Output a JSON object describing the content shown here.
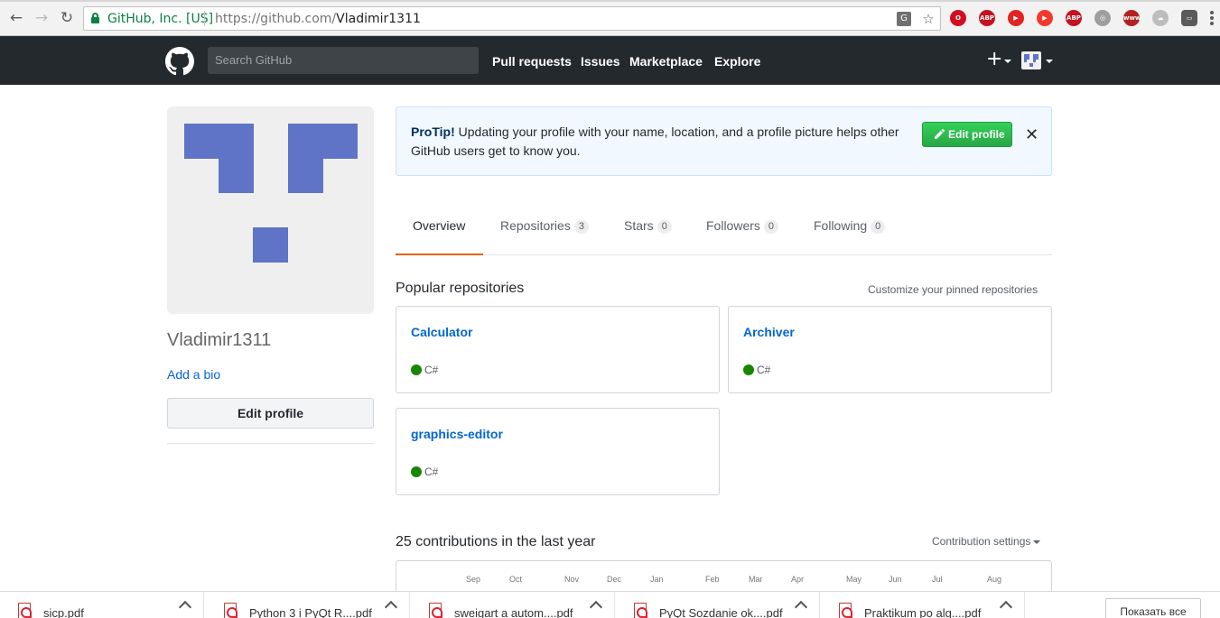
{
  "browser": {
    "secure_label": "GitHub, Inc. [US]",
    "url_prefix": "https://github.com/",
    "url_path": "Vladimir1311",
    "extensions": [
      {
        "name": "opera-icon",
        "color": "#d30d1f",
        "label": "O"
      },
      {
        "name": "adblock-icon",
        "color": "#c5131f",
        "label": "ABP"
      },
      {
        "name": "video-icon",
        "color": "#e02424",
        "label": "▶"
      },
      {
        "name": "video-speed-icon",
        "color": "#f03a2c",
        "label": "▶"
      },
      {
        "name": "adblock-plus-icon",
        "color": "#c5131f",
        "label": "ABP"
      },
      {
        "name": "proxy-icon",
        "color": "#9e9e9e",
        "label": "◎"
      },
      {
        "name": "www-icon",
        "color": "#b22222",
        "label": "www"
      },
      {
        "name": "cloud-icon",
        "color": "#bdbdbd",
        "label": "☁"
      },
      {
        "name": "cast-icon",
        "color": "#5a5a5a",
        "label": "▭"
      },
      {
        "name": "addon-icon",
        "color": "#d32f2f",
        "label": "✦"
      }
    ]
  },
  "header": {
    "search_placeholder": "Search GitHub",
    "nav": [
      "Pull requests",
      "Issues",
      "Marketplace",
      "Explore"
    ],
    "plus_label": "+"
  },
  "profile": {
    "username": "Vladimir1311",
    "add_bio": "Add a bio",
    "edit_profile": "Edit profile"
  },
  "protip": {
    "title": "ProTip!",
    "text": "Updating your profile with your name, location, and a profile picture helps other GitHub users get to know you.",
    "button": "Edit profile",
    "close": "✕"
  },
  "tabs": [
    {
      "label": "Overview",
      "count": null
    },
    {
      "label": "Repositories",
      "count": "3"
    },
    {
      "label": "Stars",
      "count": "0"
    },
    {
      "label": "Followers",
      "count": "0"
    },
    {
      "label": "Following",
      "count": "0"
    }
  ],
  "popular": {
    "title": "Popular repositories",
    "customize": "Customize your pinned repositories",
    "repos": [
      {
        "name": "Calculator",
        "language": "C#",
        "color": "#178600"
      },
      {
        "name": "Archiver",
        "language": "C#",
        "color": "#178600"
      },
      {
        "name": "graphics-editor",
        "language": "C#",
        "color": "#178600"
      }
    ]
  },
  "contributions": {
    "title": "25 contributions in the last year",
    "settings": "Contribution settings",
    "months": [
      "Sep",
      "Oct",
      "Nov",
      "Dec",
      "Jan",
      "Feb",
      "Mar",
      "Apr",
      "May",
      "Jun",
      "Jul",
      "Aug"
    ]
  },
  "downloads": {
    "items": [
      "sicp.pdf",
      "Python 3 i PyQt R....pdf",
      "sweigart a autom....pdf",
      "PyQt Sozdanie ok....pdf",
      "Praktikum po alg....pdf"
    ],
    "show_all": "Показать все"
  }
}
